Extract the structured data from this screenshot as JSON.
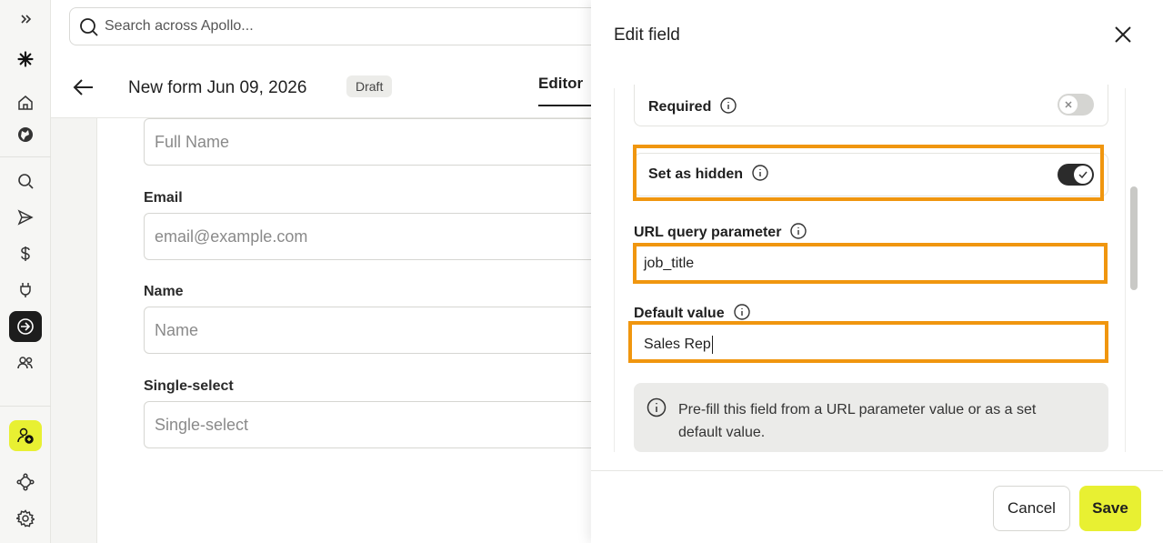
{
  "search": {
    "placeholder": "Search across Apollo..."
  },
  "header": {
    "title": "New form Jun 09, 2026",
    "status": "Draft",
    "tab": "Editor"
  },
  "form_fields": [
    {
      "label": "",
      "placeholder": "Full Name"
    },
    {
      "label": "Email",
      "placeholder": "email@example.com"
    },
    {
      "label": "Name",
      "placeholder": "Name"
    },
    {
      "label": "Single-select",
      "placeholder": "Single-select"
    }
  ],
  "panel": {
    "title": "Edit field",
    "required": {
      "label": "Required",
      "enabled": false
    },
    "hidden": {
      "label": "Set as hidden",
      "enabled": true
    },
    "url_param": {
      "label": "URL query parameter",
      "value": "job_title"
    },
    "default_value": {
      "label": "Default value",
      "value": "Sales Rep"
    },
    "note": "Pre-fill this field from a URL parameter value or as a set default value.",
    "cancel_label": "Cancel",
    "save_label": "Save"
  },
  "colors": {
    "accent": "#e8f032",
    "highlight": "#f0960f",
    "dark": "#1d1d1d"
  },
  "icons": {
    "sidebar": [
      "expand-icon",
      "logo-icon",
      "home-icon",
      "globe-icon",
      "search-icon",
      "send-icon",
      "dollar-icon",
      "plug-icon",
      "forms-icon",
      "people-icon",
      "add-user-icon",
      "workflow-icon",
      "settings-icon"
    ]
  }
}
